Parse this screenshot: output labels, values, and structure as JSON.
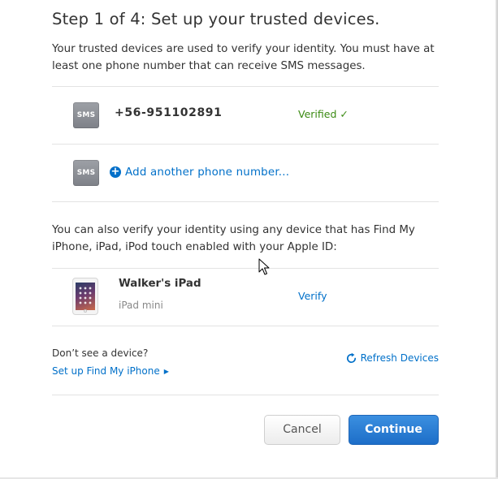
{
  "header": {
    "title": "Step 1 of 4: Set up your trusted devices."
  },
  "intro": {
    "text": "Your trusted devices are used to verify your identity. You must have at least one phone number that can receive SMS messages."
  },
  "trusted_phones": [
    {
      "icon_label": "SMS",
      "number": "+56-951102891",
      "status": "Verified ✓"
    }
  ],
  "add_phone": {
    "icon_label": "SMS",
    "label": "Add another phone number..."
  },
  "devices_intro": {
    "text": "You can also verify your identity using any device that has Find My iPhone, iPad, iPod touch enabled with your Apple ID:"
  },
  "devices": [
    {
      "name": "Walker's iPad",
      "model": "iPad mini",
      "action": "Verify"
    }
  ],
  "no_device": {
    "question": "Don’t see a device?",
    "link": "Set up Find My iPhone",
    "refresh": "Refresh Devices"
  },
  "buttons": {
    "cancel": "Cancel",
    "continue": "Continue"
  },
  "colors": {
    "link": "#0070c9",
    "verified": "#3a8a12",
    "continue_button": "#1d6ec8",
    "sms_icon": "#8a8d93",
    "divider": "#e3e3e3"
  },
  "icons": {
    "add": "plus-circle-icon",
    "refresh": "refresh-icon",
    "device": "ipad-icon",
    "sms": "sms-icon",
    "chevron": "chevron-right-icon"
  }
}
